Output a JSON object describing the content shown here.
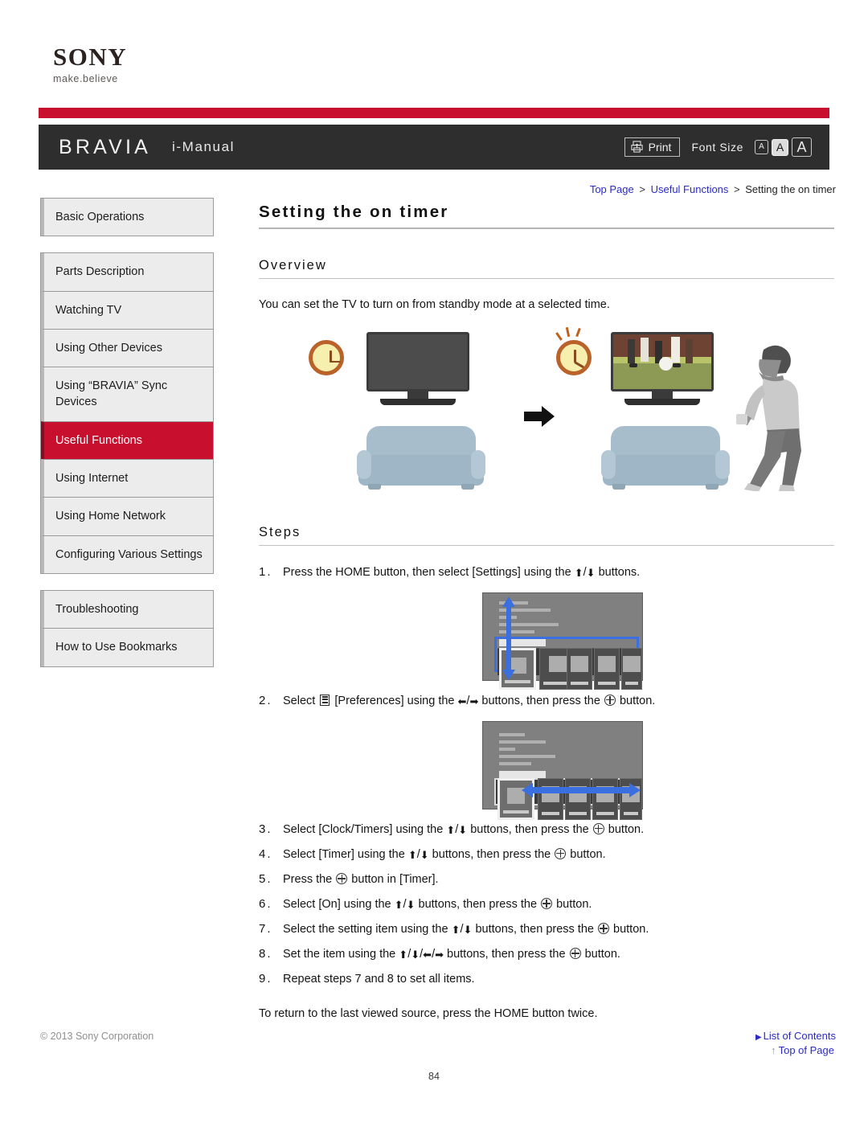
{
  "brand": {
    "logo_text": "SONY",
    "tagline": "make.believe"
  },
  "header": {
    "product": "BRAVIA",
    "manual": "i-Manual",
    "print_label": "Print",
    "font_size_label": "Font Size",
    "font_sizes": [
      "A",
      "A",
      "A"
    ],
    "selected_font_size_index": 1,
    "bar_color": "#2e2e2e",
    "accent_color": "#c8102e"
  },
  "breadcrumb": {
    "items": [
      "Top Page",
      "Useful Functions",
      "Setting the on timer"
    ],
    "separator": ">",
    "link_color": "#2b2bc4"
  },
  "sidebar": {
    "groups": [
      {
        "items": [
          {
            "label": "Basic Operations",
            "active": false
          }
        ]
      },
      {
        "items": [
          {
            "label": "Parts Description",
            "active": false
          },
          {
            "label": "Watching TV",
            "active": false
          },
          {
            "label": "Using Other Devices",
            "active": false
          },
          {
            "label": "Using “BRAVIA” Sync Devices",
            "active": false
          },
          {
            "label": "Useful Functions",
            "active": true
          },
          {
            "label": "Using Internet",
            "active": false
          },
          {
            "label": "Using Home Network",
            "active": false
          },
          {
            "label": "Configuring Various Settings",
            "active": false
          }
        ]
      },
      {
        "items": [
          {
            "label": "Troubleshooting",
            "active": false
          },
          {
            "label": "How to Use Bookmarks",
            "active": false
          }
        ]
      }
    ],
    "active_color": "#c8102e"
  },
  "main": {
    "title": "Setting the on timer",
    "overview_heading": "Overview",
    "overview_text": "You can set the TV to turn on from standby mode at a selected time.",
    "steps_heading": "Steps",
    "steps": [
      {
        "num": "1.",
        "parts": [
          {
            "t": "text",
            "v": "Press the HOME button, then select [Settings] using the "
          },
          {
            "t": "icon",
            "v": "arrow-up"
          },
          {
            "t": "text",
            "v": "/"
          },
          {
            "t": "icon",
            "v": "arrow-down"
          },
          {
            "t": "text",
            "v": " buttons."
          }
        ]
      },
      {
        "num": "2.",
        "parts": [
          {
            "t": "text",
            "v": "Select "
          },
          {
            "t": "icon",
            "v": "preferences"
          },
          {
            "t": "text",
            "v": " [Preferences] using the "
          },
          {
            "t": "icon",
            "v": "arrow-left"
          },
          {
            "t": "text",
            "v": "/"
          },
          {
            "t": "icon",
            "v": "arrow-right"
          },
          {
            "t": "text",
            "v": " buttons, then press the "
          },
          {
            "t": "icon",
            "v": "enter"
          },
          {
            "t": "text",
            "v": " button."
          }
        ]
      },
      {
        "num": "3.",
        "parts": [
          {
            "t": "text",
            "v": "Select [Clock/Timers] using the "
          },
          {
            "t": "icon",
            "v": "arrow-up"
          },
          {
            "t": "text",
            "v": "/"
          },
          {
            "t": "icon",
            "v": "arrow-down"
          },
          {
            "t": "text",
            "v": " buttons, then press the "
          },
          {
            "t": "icon",
            "v": "enter"
          },
          {
            "t": "text",
            "v": " button."
          }
        ]
      },
      {
        "num": "4.",
        "parts": [
          {
            "t": "text",
            "v": "Select [Timer] using the "
          },
          {
            "t": "icon",
            "v": "arrow-up"
          },
          {
            "t": "text",
            "v": "/"
          },
          {
            "t": "icon",
            "v": "arrow-down"
          },
          {
            "t": "text",
            "v": " buttons, then press the "
          },
          {
            "t": "icon",
            "v": "enter"
          },
          {
            "t": "text",
            "v": " button."
          }
        ]
      },
      {
        "num": "5.",
        "parts": [
          {
            "t": "text",
            "v": "Press the "
          },
          {
            "t": "icon",
            "v": "enter"
          },
          {
            "t": "text",
            "v": " button in [Timer]."
          }
        ]
      },
      {
        "num": "6.",
        "parts": [
          {
            "t": "text",
            "v": "Select [On] using the "
          },
          {
            "t": "icon",
            "v": "arrow-up"
          },
          {
            "t": "text",
            "v": "/"
          },
          {
            "t": "icon",
            "v": "arrow-down"
          },
          {
            "t": "text",
            "v": " buttons, then press the "
          },
          {
            "t": "icon",
            "v": "enter"
          },
          {
            "t": "text",
            "v": " button."
          }
        ]
      },
      {
        "num": "7.",
        "parts": [
          {
            "t": "text",
            "v": "Select the setting item using the "
          },
          {
            "t": "icon",
            "v": "arrow-up"
          },
          {
            "t": "text",
            "v": "/"
          },
          {
            "t": "icon",
            "v": "arrow-down"
          },
          {
            "t": "text",
            "v": " buttons, then press the "
          },
          {
            "t": "icon",
            "v": "enter"
          },
          {
            "t": "text",
            "v": " button."
          }
        ]
      },
      {
        "num": "8.",
        "parts": [
          {
            "t": "text",
            "v": "Set the item using the "
          },
          {
            "t": "icon",
            "v": "arrow-up"
          },
          {
            "t": "text",
            "v": "/"
          },
          {
            "t": "icon",
            "v": "arrow-down"
          },
          {
            "t": "text",
            "v": "/"
          },
          {
            "t": "icon",
            "v": "arrow-left"
          },
          {
            "t": "text",
            "v": "/"
          },
          {
            "t": "icon",
            "v": "arrow-right"
          },
          {
            "t": "text",
            "v": " buttons, then press the "
          },
          {
            "t": "icon",
            "v": "enter"
          },
          {
            "t": "text",
            "v": " button."
          }
        ]
      },
      {
        "num": "9.",
        "parts": [
          {
            "t": "text",
            "v": "Repeat steps 7 and 8 to set all items."
          }
        ]
      }
    ],
    "closing_text": "To return to the last viewed source, press the HOME button twice.",
    "top_of_page": "Top of Page"
  },
  "illustration": {
    "left_scene": {
      "tv_state": "off",
      "clock": "clock",
      "sofa": "sofa"
    },
    "right_scene": {
      "tv_state": "on-soccer",
      "clock": "alarm-ringing",
      "sofa": "sofa",
      "person": "person-walking"
    },
    "transition": "arrow-right",
    "sofa_color": "#a8bdcc",
    "clock_color": "#f6efae",
    "clock_rim_color": "#b9622a"
  },
  "menu_shots": [
    {
      "arrow": "vertical",
      "selected_tile_index": 0,
      "highlight": "blue-box"
    },
    {
      "arrow": "horizontal",
      "selected_tile_index": 0,
      "highlight": "none"
    }
  ],
  "footer": {
    "copyright": "© 2013 Sony Corporation",
    "list_of_contents": "List of Contents",
    "page_number": "84"
  }
}
